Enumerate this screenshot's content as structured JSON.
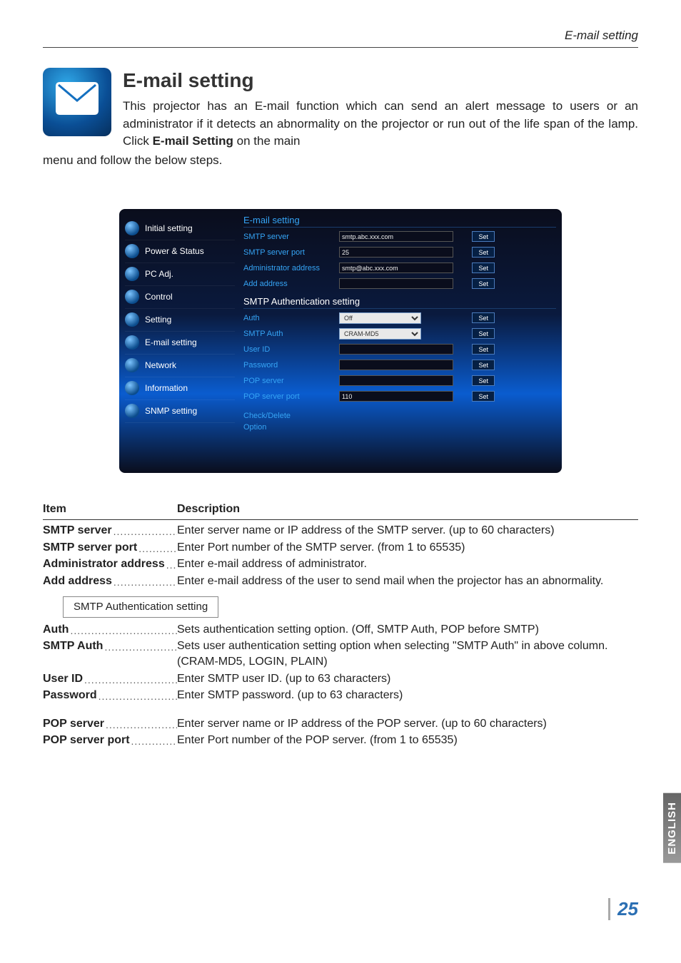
{
  "header_right": "E-mail setting",
  "title": "E-mail setting",
  "intro_wrapped": "This projector has an E-mail function which can send an alert message to users or an administrator if it detects an abnormality on the projector or run out of the life span of the lamp. Click ",
  "intro_bold": "E-mail Setting",
  "intro_after_bold": " on the main",
  "intro_cont": "menu and follow the below steps.",
  "screenshot": {
    "sidebar": [
      "Initial setting",
      "Power & Status",
      "PC Adj.",
      "Control",
      "Setting",
      "E-mail setting",
      "Network",
      "Information",
      "SNMP setting"
    ],
    "section1_title": "E-mail setting",
    "rows1": [
      {
        "label": "SMTP server",
        "value": "smtp.abc.xxx.com",
        "btn": "Set"
      },
      {
        "label": "SMTP server port",
        "value": "25",
        "btn": "Set"
      },
      {
        "label": "Administrator address",
        "value": "smtp@abc.xxx.com",
        "btn": "Set"
      },
      {
        "label": "Add address",
        "value": "",
        "btn": "Set"
      }
    ],
    "section2_title": "SMTP Authentication setting",
    "sel_rows": [
      {
        "label": "Auth",
        "value": "Off",
        "btn": "Set"
      },
      {
        "label": "SMTP Auth",
        "value": "CRAM-MD5",
        "btn": "Set"
      }
    ],
    "rows2": [
      {
        "label": "User ID",
        "value": "",
        "btn": "Set"
      },
      {
        "label": "Password",
        "value": "",
        "btn": "Set"
      },
      {
        "label": "POP server",
        "value": "",
        "btn": "Set"
      },
      {
        "label": "POP server port",
        "value": "110",
        "btn": "Set"
      }
    ],
    "check_delete": "Check/Delete",
    "option": "Option"
  },
  "columns": {
    "item": "Item",
    "desc": "Description"
  },
  "items1": [
    {
      "term": "SMTP server",
      "desc": "Enter server name or IP address of the SMTP server. (up to 60 characters)"
    },
    {
      "term": "SMTP server port",
      "desc": "Enter Port number of the SMTP server. (from 1 to 65535)"
    },
    {
      "term": "Administrator address",
      "desc": "Enter e-mail address of administrator."
    },
    {
      "term": "Add address",
      "desc": "Enter e-mail address of the user to send mail when the projector has an abnormality."
    }
  ],
  "sub_heading": "SMTP Authentication setting",
  "items2": [
    {
      "term": "Auth",
      "desc": "Sets authentication setting option. (Off, SMTP Auth, POP before SMTP)"
    },
    {
      "term": "SMTP Auth",
      "desc": "Sets user authentication setting option when selecting \"SMTP Auth\" in above column. (CRAM-MD5, LOGIN, PLAIN)"
    },
    {
      "term": "User ID",
      "desc": "Enter SMTP user ID. (up to 63 characters)"
    },
    {
      "term": "Password",
      "desc": "Enter SMTP password. (up to 63 characters)"
    }
  ],
  "items3": [
    {
      "term": "POP server",
      "desc": "Enter server name or IP address of the POP server. (up to 60 characters)"
    },
    {
      "term": "POP server port",
      "desc": "Enter Port number of the POP server. (from 1 to 65535)"
    }
  ],
  "side_tab": "ENGLISH",
  "page_number": "25"
}
